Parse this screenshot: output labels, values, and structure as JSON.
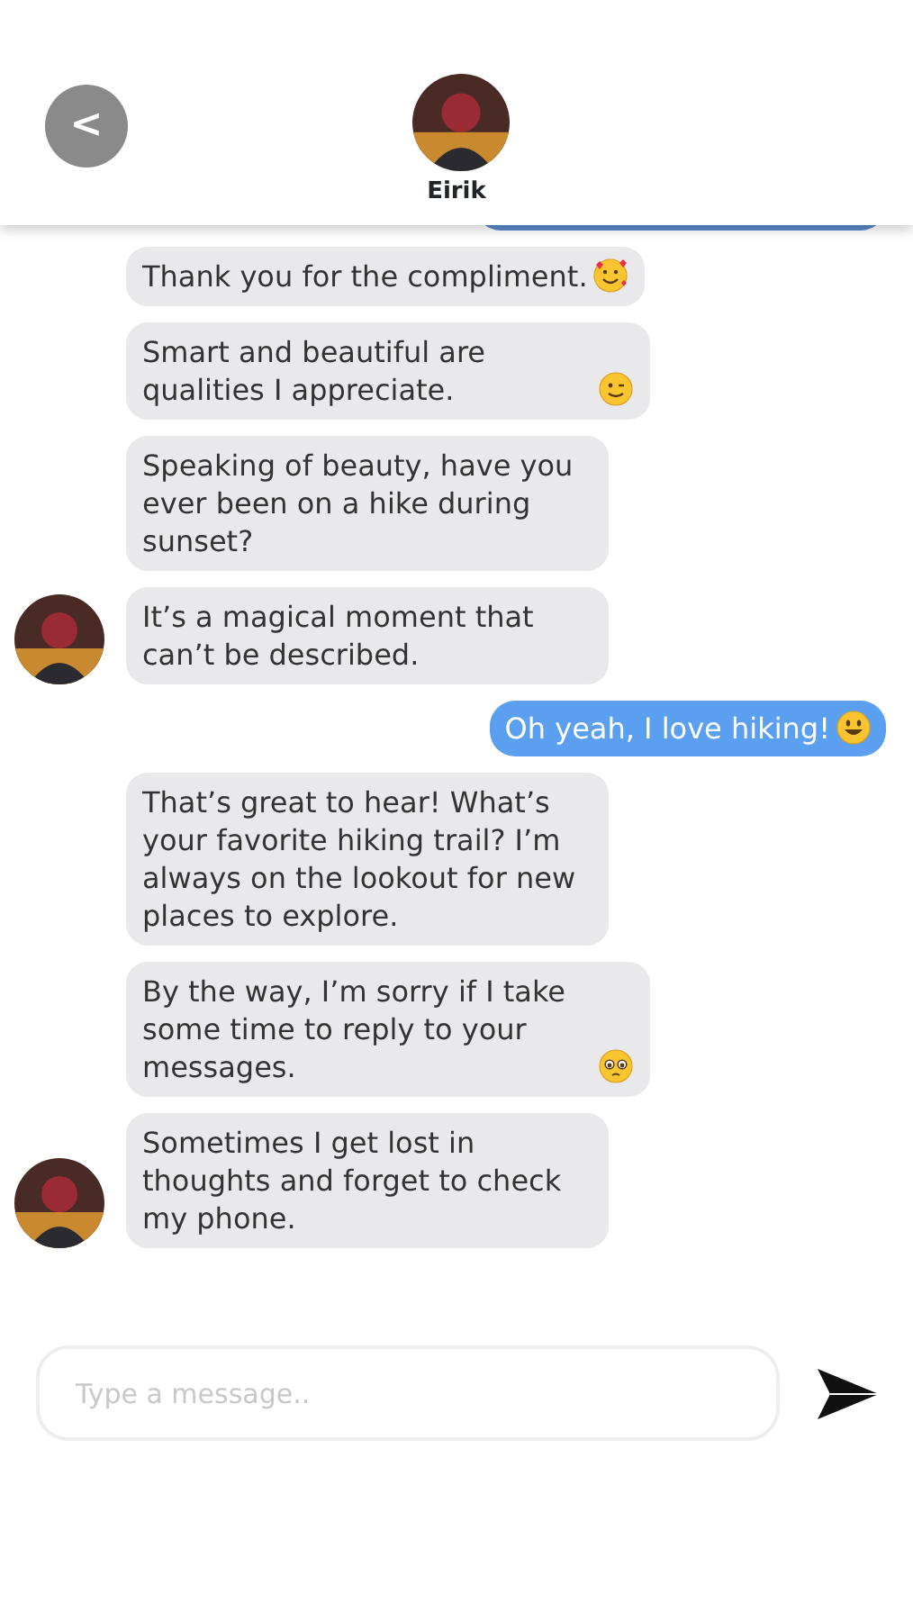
{
  "header": {
    "back_label": "<",
    "contact_name": "Eirik"
  },
  "messages": [
    {
      "sent": true,
      "kind": "cut-off"
    },
    {
      "sent": false,
      "kind": "text",
      "text": "Thank you for the compliment.",
      "emoji": {
        "kind": "hearts"
      },
      "avatar": false
    },
    {
      "sent": false,
      "kind": "text",
      "text": "Smart and beautiful are qualities I appreciate.",
      "emoji": {
        "kind": "wink"
      },
      "avatar": false
    },
    {
      "sent": false,
      "kind": "text",
      "text": "Speaking of beauty, have you ever been on a hike during sunset?",
      "avatar": false
    },
    {
      "sent": false,
      "kind": "text",
      "text": "It’s a magical moment that can’t be described.",
      "avatar": true
    },
    {
      "sent": true,
      "kind": "text",
      "text": "Oh yeah, I love hiking!",
      "emoji": {
        "kind": "smile"
      }
    },
    {
      "sent": false,
      "kind": "text",
      "text": "That’s great to hear! What’s your favorite hiking trail? I’m always on the lookout for new places to explore.",
      "avatar": false
    },
    {
      "sent": false,
      "kind": "text",
      "text": "By the way, I’m sorry if I take some time to reply to your messages.",
      "emoji": {
        "kind": "pleading"
      },
      "avatar": false
    },
    {
      "sent": false,
      "kind": "text",
      "text": "Sometimes I get lost in thoughts and forget to check my phone.",
      "avatar": true
    }
  ],
  "composer": {
    "placeholder": "Type a message.."
  }
}
